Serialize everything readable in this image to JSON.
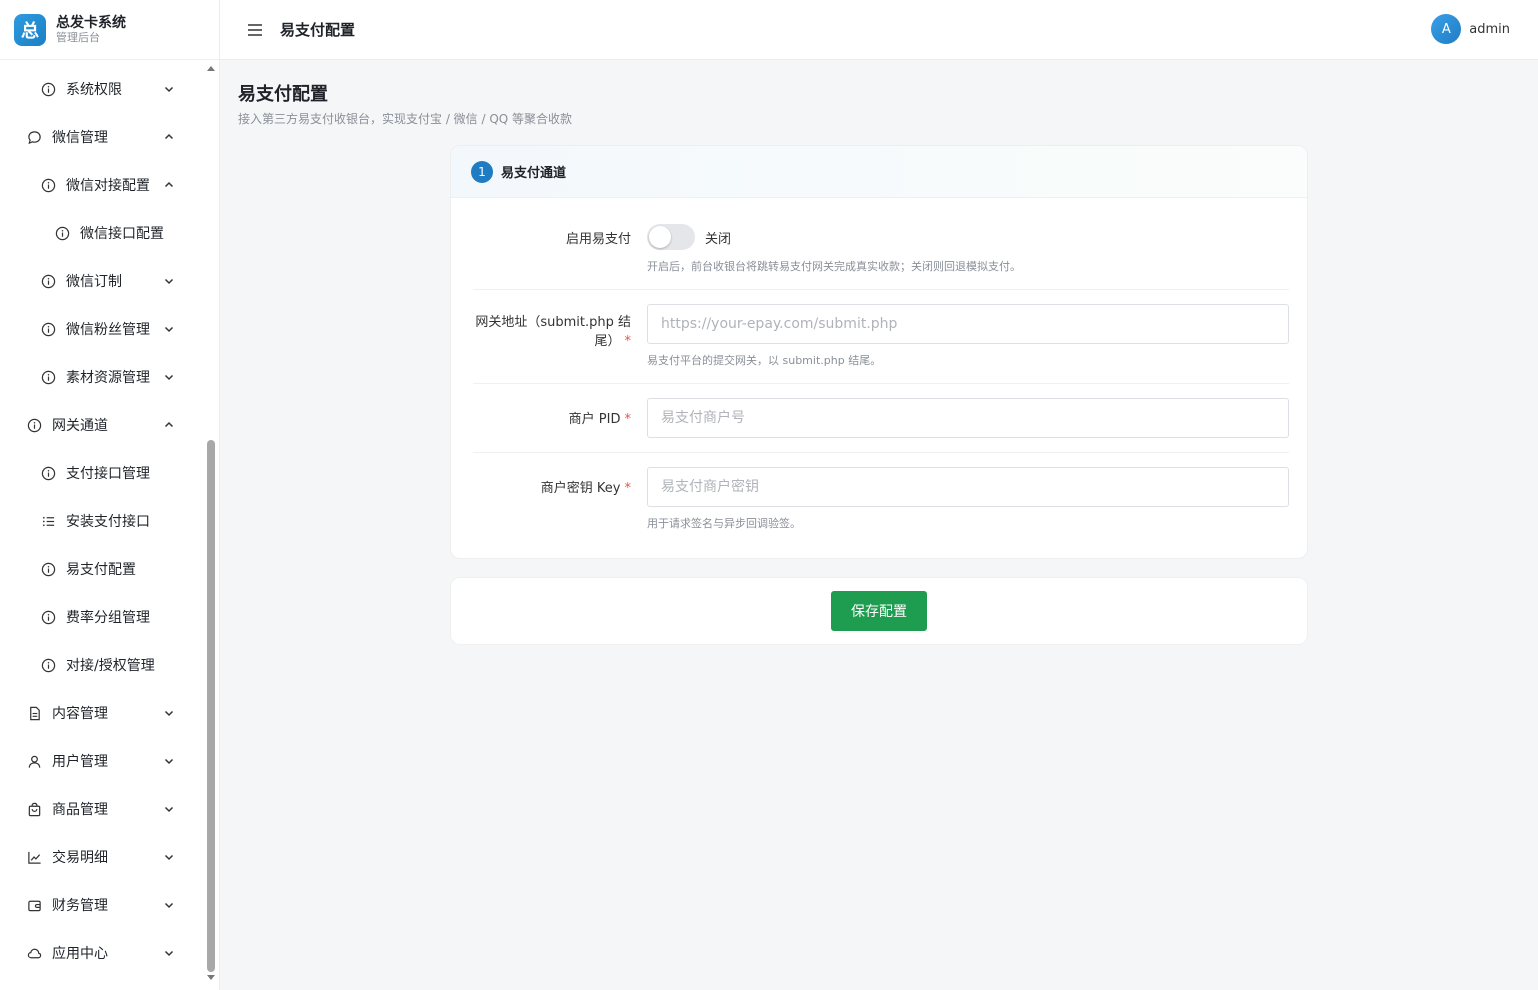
{
  "brand": {
    "logo_char": "总",
    "title": "总发卡系统",
    "subtitle": "管理后台"
  },
  "sidebar": {
    "items": [
      {
        "label": "系统权限",
        "icon": "info-circle-icon",
        "expanded": false
      },
      {
        "label": "微信管理",
        "icon": "chat-bubble-icon",
        "expanded": true
      },
      {
        "label": "微信对接配置",
        "icon": "info-circle-icon",
        "expanded": true
      },
      {
        "label": "微信接口配置",
        "icon": "info-circle-icon"
      },
      {
        "label": "微信订制",
        "icon": "info-circle-icon",
        "expanded": false
      },
      {
        "label": "微信粉丝管理",
        "icon": "info-circle-icon",
        "expanded": false
      },
      {
        "label": "素材资源管理",
        "icon": "info-circle-icon",
        "expanded": false
      },
      {
        "label": "网关通道",
        "icon": "info-circle-icon",
        "expanded": true
      },
      {
        "label": "支付接口管理",
        "icon": "info-circle-icon"
      },
      {
        "label": "安装支付接口",
        "icon": "list-icon"
      },
      {
        "label": "易支付配置",
        "icon": "info-circle-icon",
        "active": true
      },
      {
        "label": "费率分组管理",
        "icon": "info-circle-icon"
      },
      {
        "label": "对接/授权管理",
        "icon": "info-circle-icon"
      },
      {
        "label": "内容管理",
        "icon": "document-icon",
        "expanded": false
      },
      {
        "label": "用户管理",
        "icon": "user-icon",
        "expanded": false
      },
      {
        "label": "商品管理",
        "icon": "shopping-bag-icon",
        "expanded": false
      },
      {
        "label": "交易明细",
        "icon": "line-chart-icon",
        "expanded": false
      },
      {
        "label": "财务管理",
        "icon": "wallet-icon",
        "expanded": false
      },
      {
        "label": "应用中心",
        "icon": "cloud-icon",
        "expanded": false
      }
    ]
  },
  "header": {
    "title": "易支付配置",
    "user": {
      "avatar_letter": "A",
      "name": "admin"
    }
  },
  "page": {
    "title": "易支付配置",
    "description": "接入第三方易支付收银台，实现支付宝 / 微信 / QQ 等聚合收款"
  },
  "card": {
    "step": "1",
    "title": "易支付通道",
    "enable": {
      "label": "启用易支付",
      "state_text": "关闭",
      "on": false,
      "hint": "开启后，前台收银台将跳转易支付网关完成真实收款；关闭则回退模拟支付。"
    },
    "gateway": {
      "label_line1": "网关地址（submit.php 结",
      "label_line2": "尾）",
      "required": "*",
      "placeholder": "https://your-epay.com/submit.php",
      "value": "",
      "hint": "易支付平台的提交网关，以 submit.php 结尾。"
    },
    "pid": {
      "label": "商户 PID",
      "required": "*",
      "placeholder": "易支付商户号",
      "value": ""
    },
    "key": {
      "label": "商户密钥 Key",
      "required": "*",
      "placeholder": "易支付商户密钥",
      "value": "",
      "hint": "用于请求签名与异步回调验签。"
    }
  },
  "footer": {
    "save_label": "保存配置"
  },
  "colors": {
    "primary_blue": "#1f7cc3",
    "save_green": "#1e9c4f",
    "required_red": "#e5534b"
  }
}
